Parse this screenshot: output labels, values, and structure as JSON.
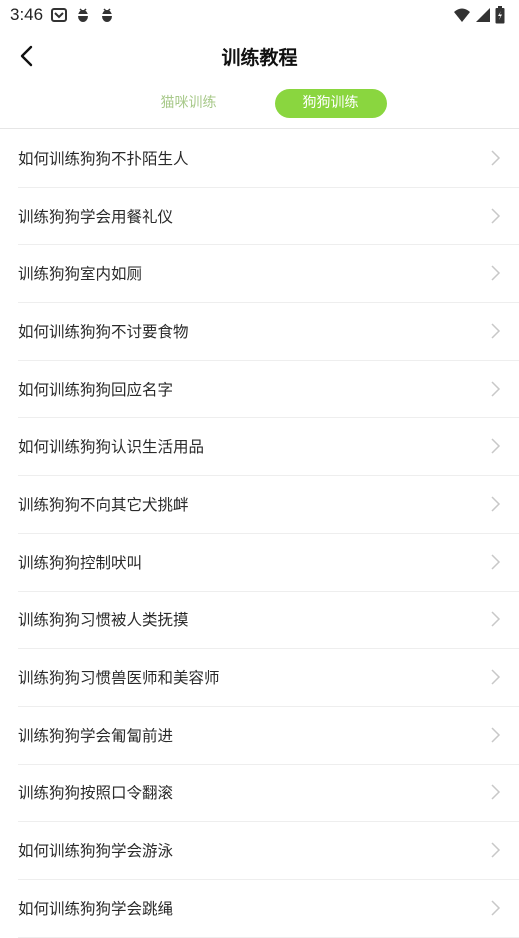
{
  "status_bar": {
    "time": "3:46",
    "notification_icons": [
      "app-notification-icon",
      "bug-icon",
      "bug-icon"
    ],
    "right_icons": [
      "wifi-icon",
      "signal-icon",
      "battery-icon"
    ]
  },
  "header": {
    "title": "训练教程",
    "back_icon": "chevron-left-icon"
  },
  "tabs": [
    {
      "label": "猫咪训练",
      "active": false
    },
    {
      "label": "狗狗训练",
      "active": true
    }
  ],
  "colors": {
    "accent": "#8ad63f",
    "inactive_tab_text": "#a8c98a",
    "divider": "#eeeeee"
  },
  "items": [
    {
      "label": "如何训练狗狗不扑陌生人"
    },
    {
      "label": "训练狗狗学会用餐礼仪"
    },
    {
      "label": "训练狗狗室内如厕"
    },
    {
      "label": "如何训练狗狗不讨要食物"
    },
    {
      "label": "如何训练狗狗回应名字"
    },
    {
      "label": "如何训练狗狗认识生活用品"
    },
    {
      "label": "训练狗狗不向其它犬挑衅"
    },
    {
      "label": "训练狗狗控制吠叫"
    },
    {
      "label": "训练狗狗习惯被人类抚摸"
    },
    {
      "label": "训练狗狗习惯兽医师和美容师"
    },
    {
      "label": "训练狗狗学会匍匐前进"
    },
    {
      "label": "训练狗狗按照口令翻滚"
    },
    {
      "label": "如何训练狗狗学会游泳"
    },
    {
      "label": "如何训练狗狗学会跳绳"
    }
  ]
}
